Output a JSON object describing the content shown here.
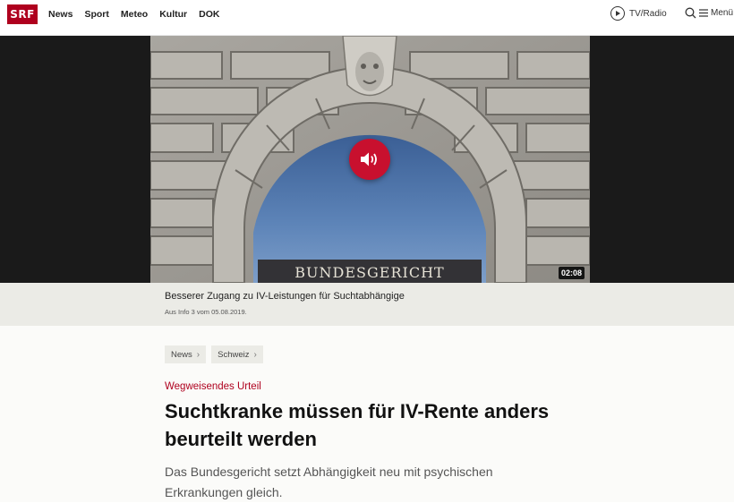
{
  "header": {
    "logo": "SRF",
    "nav": [
      "News",
      "Sport",
      "Meteo",
      "Kultur",
      "DOK"
    ],
    "tv_radio": "TV/Radio",
    "menu": "Menü"
  },
  "media": {
    "building_text": "BUNDESGERICHT",
    "duration": "02:08",
    "accent": "#c8102e",
    "speaker_icon": "speaker-icon"
  },
  "caption": {
    "title": "Besserer Zugang zu IV-Leistungen für Suchtabhängige",
    "source": "Aus Info 3 vom 05.08.2019."
  },
  "breadcrumbs": [
    "News",
    "Schweiz"
  ],
  "article": {
    "kicker": "Wegweisendes Urteil",
    "headline": "Suchtkranke müssen für IV-Rente anders beurteilt werden",
    "lead": "Das Bundesgericht setzt Abhängigkeit neu mit psychischen Erkrankungen gleich."
  }
}
